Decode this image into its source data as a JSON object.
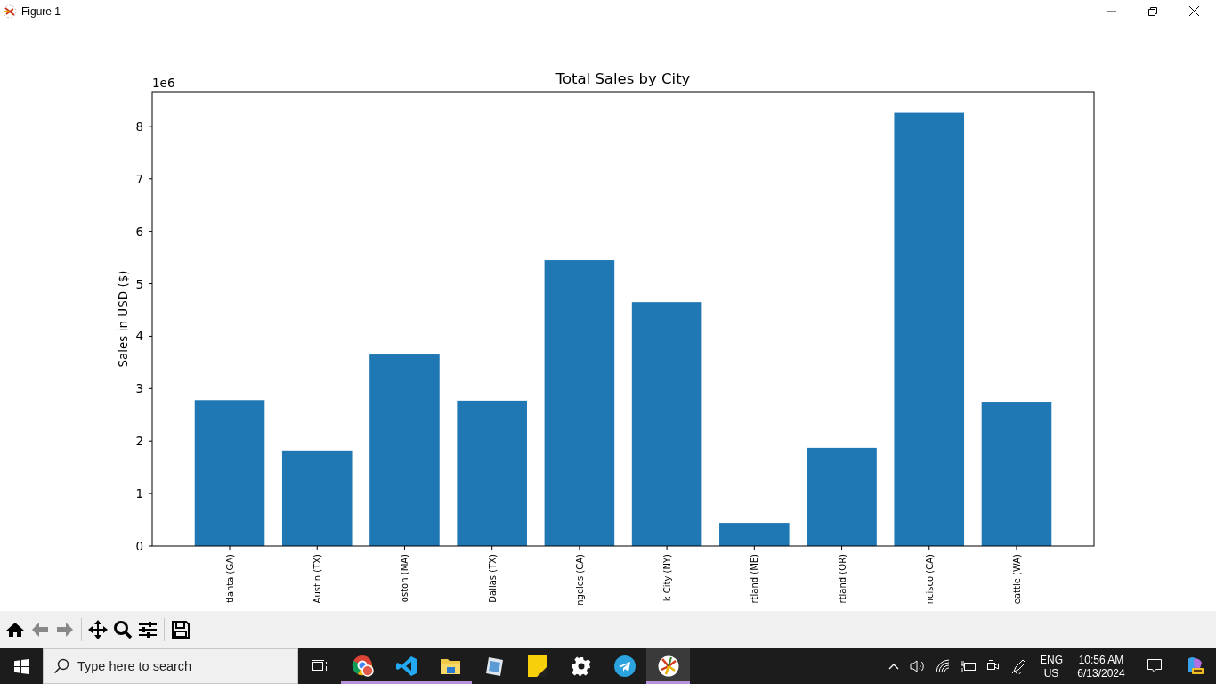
{
  "window": {
    "title": "Figure 1"
  },
  "figure": {
    "offset_label": "1e6",
    "chart_data": {
      "type": "bar",
      "title": "Total Sales by City",
      "ylabel": "Sales in USD ($)",
      "categories": [
        "tlanta (GA)",
        "Austin (TX)",
        "oston (MA)",
        "Dallas (TX)",
        "ngeles (CA)",
        "k City (NY)",
        "rtland (ME)",
        "rtland (OR)",
        "ncisco (CA)",
        "eattle (WA)"
      ],
      "series": [
        {
          "color": "#1f77b4",
          "values": [
            2.78,
            1.82,
            3.65,
            2.77,
            5.45,
            4.65,
            0.44,
            1.87,
            8.26,
            2.75
          ]
        }
      ],
      "ylim": [
        0,
        8.66
      ],
      "yticks": [
        0,
        1,
        2,
        3,
        4,
        5,
        6,
        7,
        8
      ]
    }
  },
  "taskbar": {
    "search": {
      "placeholder": "Type here to search"
    },
    "apps": [
      {
        "kind": "browser",
        "open": true,
        "selected": false
      },
      {
        "kind": "editor",
        "open": true,
        "selected": false
      },
      {
        "kind": "folder",
        "open": true,
        "selected": false
      },
      {
        "kind": "document",
        "open": false,
        "selected": false
      },
      {
        "kind": "notes",
        "open": false,
        "selected": false
      },
      {
        "kind": "settings",
        "open": false,
        "selected": false
      },
      {
        "kind": "messenger",
        "open": false,
        "selected": false
      },
      {
        "kind": "plot",
        "open": true,
        "selected": true
      }
    ],
    "language": [
      "ENG",
      "US"
    ],
    "time": "10:56 AM",
    "date": "6/13/2024"
  }
}
